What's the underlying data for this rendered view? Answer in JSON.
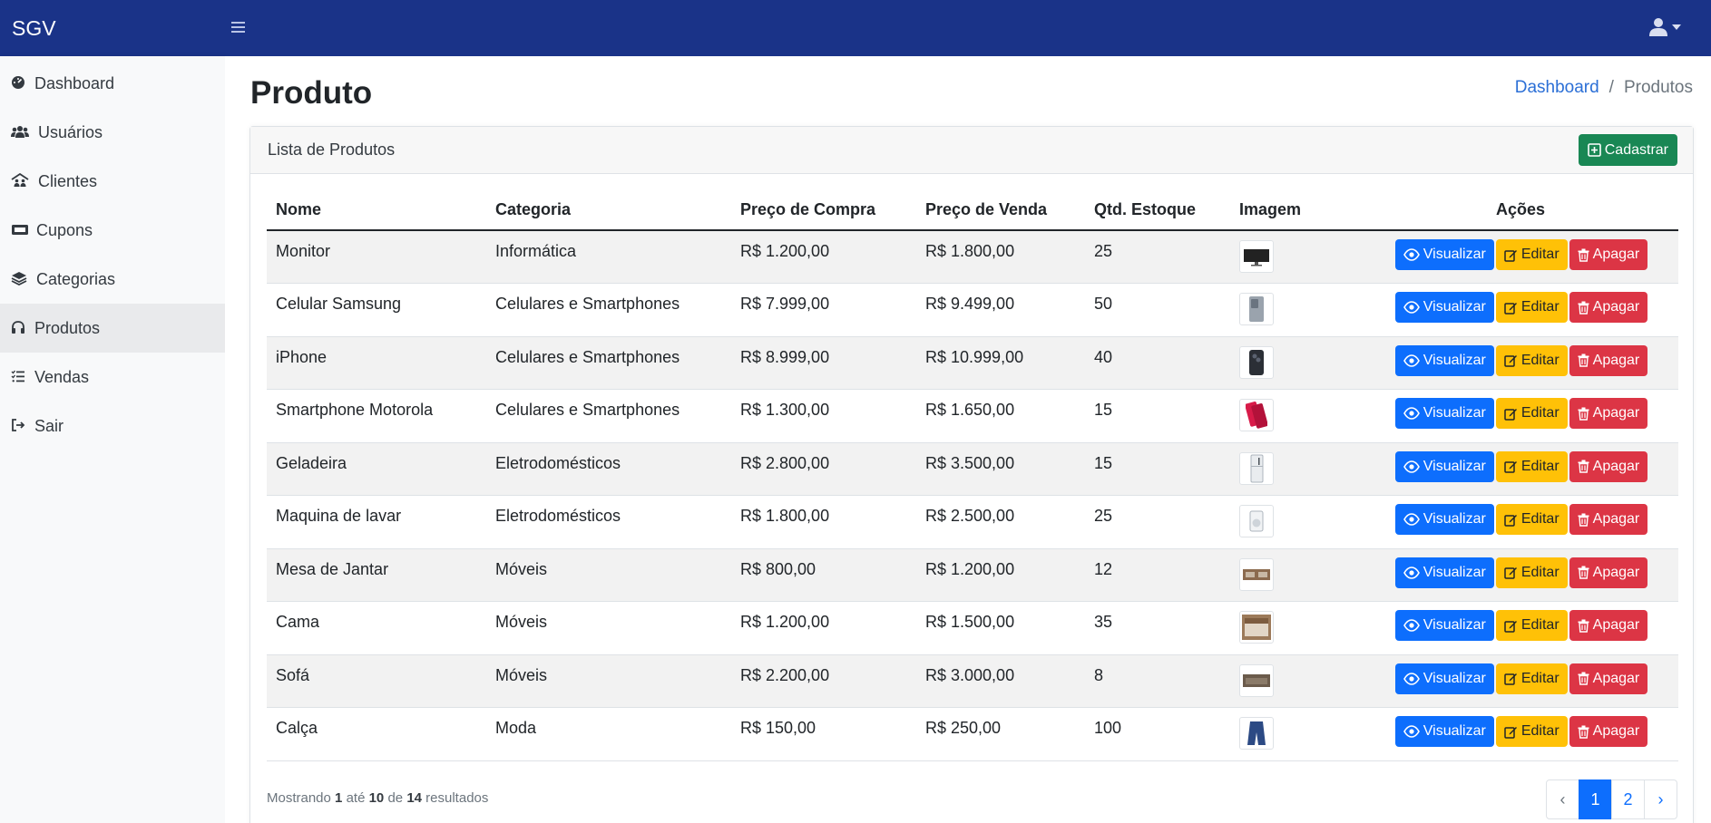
{
  "app": {
    "brand": "SGV"
  },
  "sidebar": {
    "items": [
      {
        "label": "Dashboard",
        "icon": "gauge-icon"
      },
      {
        "label": "Usuários",
        "icon": "users-icon"
      },
      {
        "label": "Clientes",
        "icon": "people-roof-icon"
      },
      {
        "label": "Cupons",
        "icon": "ticket-icon"
      },
      {
        "label": "Categorias",
        "icon": "layers-icon"
      },
      {
        "label": "Produtos",
        "icon": "headphones-icon",
        "active": true
      },
      {
        "label": "Vendas",
        "icon": "list-check-icon"
      },
      {
        "label": "Sair",
        "icon": "sign-out-icon"
      }
    ]
  },
  "page": {
    "title": "Produto",
    "breadcrumb": {
      "link": "Dashboard",
      "separator": "/",
      "current": "Produtos"
    }
  },
  "card": {
    "title": "Lista de Produtos",
    "add_button": "Cadastrar"
  },
  "table": {
    "columns": [
      "Nome",
      "Categoria",
      "Preço de Compra",
      "Preço de Venda",
      "Qtd. Estoque",
      "Imagem",
      "Ações"
    ],
    "action_labels": {
      "view": "Visualizar",
      "edit": "Editar",
      "delete": "Apagar"
    },
    "rows": [
      {
        "nome": "Monitor",
        "categoria": "Informática",
        "compra": "R$ 1.200,00",
        "venda": "R$ 1.800,00",
        "estoque": "25",
        "imagem": "monitor"
      },
      {
        "nome": "Celular Samsung",
        "categoria": "Celulares e Smartphones",
        "compra": "R$ 7.999,00",
        "venda": "R$ 9.499,00",
        "estoque": "50",
        "imagem": "phone-gray"
      },
      {
        "nome": "iPhone",
        "categoria": "Celulares e Smartphones",
        "compra": "R$ 8.999,00",
        "venda": "R$ 10.999,00",
        "estoque": "40",
        "imagem": "phone-dark"
      },
      {
        "nome": "Smartphone Motorola",
        "categoria": "Celulares e Smartphones",
        "compra": "R$ 1.300,00",
        "venda": "R$ 1.650,00",
        "estoque": "15",
        "imagem": "phone-red"
      },
      {
        "nome": "Geladeira",
        "categoria": "Eletrodomésticos",
        "compra": "R$ 2.800,00",
        "venda": "R$ 3.500,00",
        "estoque": "15",
        "imagem": "fridge"
      },
      {
        "nome": "Maquina de lavar",
        "categoria": "Eletrodomésticos",
        "compra": "R$ 1.800,00",
        "venda": "R$ 2.500,00",
        "estoque": "25",
        "imagem": "washer"
      },
      {
        "nome": "Mesa de Jantar",
        "categoria": "Móveis",
        "compra": "R$ 800,00",
        "venda": "R$ 1.200,00",
        "estoque": "12",
        "imagem": "table"
      },
      {
        "nome": "Cama",
        "categoria": "Móveis",
        "compra": "R$ 1.200,00",
        "venda": "R$ 1.500,00",
        "estoque": "35",
        "imagem": "bed"
      },
      {
        "nome": "Sofá",
        "categoria": "Móveis",
        "compra": "R$ 2.200,00",
        "venda": "R$ 3.000,00",
        "estoque": "8",
        "imagem": "sofa"
      },
      {
        "nome": "Calça",
        "categoria": "Moda",
        "compra": "R$ 150,00",
        "venda": "R$ 250,00",
        "estoque": "100",
        "imagem": "jeans"
      }
    ]
  },
  "footer": {
    "prefix": "Mostrando",
    "from": "1",
    "to_word": "até",
    "to": "10",
    "of_word": "de",
    "total": "14",
    "suffix": "resultados"
  },
  "pagination": {
    "prev": "‹",
    "pages": [
      "1",
      "2"
    ],
    "next": "›",
    "current": "1"
  },
  "colors": {
    "topbar": "#1a3388",
    "primary": "#0d6efd",
    "success": "#198754",
    "warning": "#ffc107",
    "danger": "#dc3545"
  }
}
